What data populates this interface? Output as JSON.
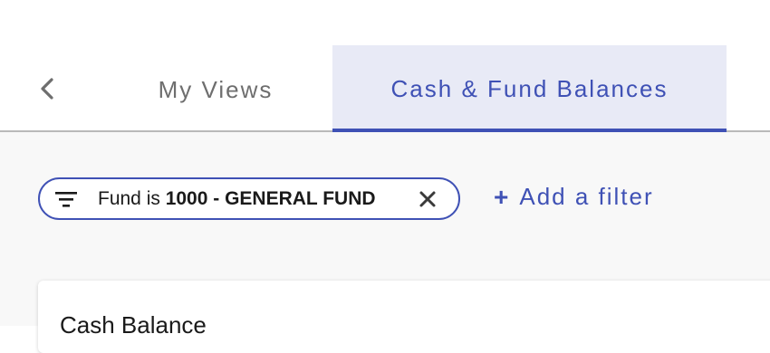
{
  "tabs": {
    "back_icon": "chevron-left-icon",
    "items": [
      {
        "label": "My Views",
        "active": false
      },
      {
        "label": "Cash & Fund Balances",
        "active": true
      }
    ]
  },
  "filter_chip": {
    "icon": "filter-list-icon",
    "prefix": "Fund is ",
    "value": "1000 - GENERAL FUND",
    "close_icon": "close-icon"
  },
  "add_filter": {
    "icon": "plus-icon",
    "label": "Add a filter"
  },
  "card": {
    "title": "Cash Balance"
  },
  "colors": {
    "accent": "#3f51b5",
    "active_tab_bg": "#e8eaf6",
    "inactive_tab_text": "#6e6e6e",
    "content_bg": "#f8f8f8"
  }
}
